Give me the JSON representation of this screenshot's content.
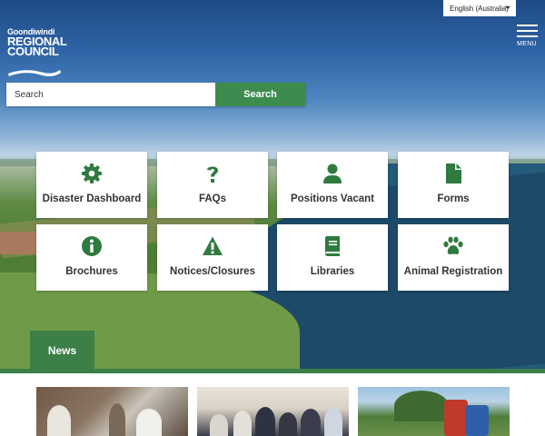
{
  "header": {
    "logo": {
      "line1": "Goondiwindi",
      "line2": "REGIONAL",
      "line3": "COUNCIL"
    },
    "language": "English (Australia)",
    "menu_label": "MENU"
  },
  "search": {
    "placeholder": "Search",
    "button_label": "Search"
  },
  "tiles": [
    {
      "label": "Disaster Dashboard",
      "icon": "gear-icon"
    },
    {
      "label": "FAQs",
      "icon": "question-icon"
    },
    {
      "label": "Positions Vacant",
      "icon": "user-icon"
    },
    {
      "label": "Forms",
      "icon": "document-icon"
    },
    {
      "label": "Brochures",
      "icon": "info-icon"
    },
    {
      "label": "Notices/Closures",
      "icon": "warning-icon"
    },
    {
      "label": "Libraries",
      "icon": "book-icon"
    },
    {
      "label": "Animal Registration",
      "icon": "paw-icon"
    }
  ],
  "news": {
    "tab_label": "News"
  },
  "colors": {
    "accent_green": "#3c8048",
    "button_green": "#3d8b4d",
    "icon_green": "#2e7a3f"
  }
}
